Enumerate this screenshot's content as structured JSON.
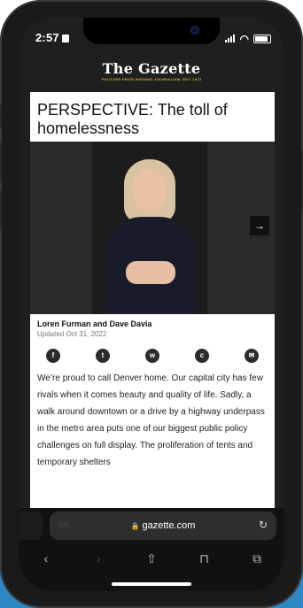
{
  "status_bar": {
    "time": "2:57"
  },
  "masthead": {
    "logo": "The Gazette",
    "tagline": "PULITZER PRIZE-WINNING JOURNALISM, EST. 1872"
  },
  "article": {
    "headline": "PERSPECTIVE: The toll of homelessness",
    "authors": "Loren Furman and Dave Davia",
    "updated": "Updated Oct 31, 2022",
    "body": "We’re proud to call Denver home. Our capital city has few rivals when it comes beauty and quality of life. Sadly, a walk around downtown or a drive by a highway underpass in the metro area puts one of our biggest public policy challenges on full display. The proliferation of tents and temporary shelters"
  },
  "share_icons": [
    {
      "name": "facebook-icon",
      "glyph": "f"
    },
    {
      "name": "twitter-icon",
      "glyph": "t"
    },
    {
      "name": "whatsapp-icon",
      "glyph": "w"
    },
    {
      "name": "comment-icon",
      "glyph": "c"
    },
    {
      "name": "email-icon",
      "glyph": "✉"
    }
  ],
  "browser": {
    "text_size_label": "aA",
    "url": "gazette.com",
    "toolbar": {
      "back": "‹",
      "forward": "›",
      "share": "⇧",
      "bookmarks": "⊓",
      "tabs": "⧉"
    }
  }
}
